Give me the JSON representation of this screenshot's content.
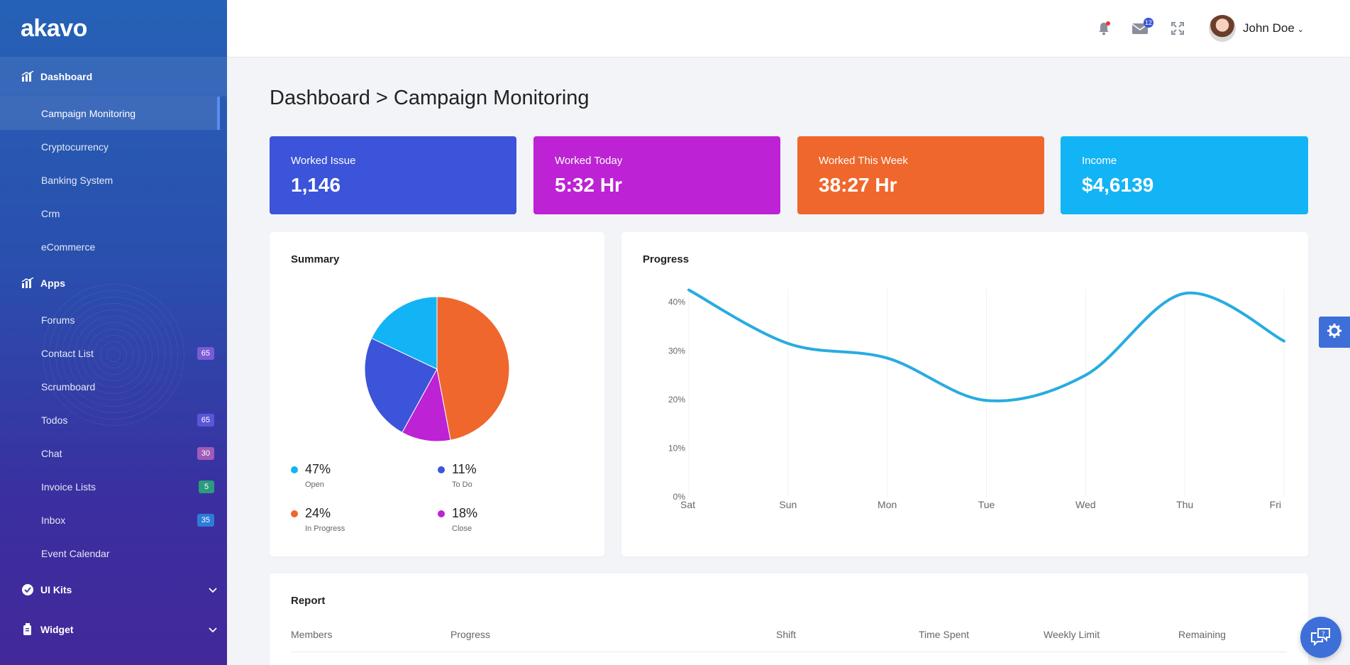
{
  "brand": "akavo",
  "colors": {
    "blue": "#3b54d9",
    "magenta": "#bd22d4",
    "orange": "#ef672c",
    "cyan": "#13b4f5",
    "line": "#28ace0"
  },
  "sidebar": {
    "dashboard": {
      "label": "Dashboard",
      "items": [
        {
          "label": "Campaign Monitoring",
          "active": true
        },
        {
          "label": "Cryptocurrency"
        },
        {
          "label": "Banking System"
        },
        {
          "label": "Crm"
        },
        {
          "label": "eCommerce"
        }
      ]
    },
    "apps": {
      "label": "Apps",
      "items": [
        {
          "label": "Forums",
          "badge": ""
        },
        {
          "label": "Contact List",
          "badge": "65",
          "badge_color": "#7a5ad6"
        },
        {
          "label": "Scrumboard",
          "badge": ""
        },
        {
          "label": "Todos",
          "badge": "65",
          "badge_color": "#5a56d9"
        },
        {
          "label": "Chat",
          "badge": "30",
          "badge_color": "#a05bb8"
        },
        {
          "label": "Invoice Lists",
          "badge": "5",
          "badge_color": "#2b9c7c"
        },
        {
          "label": "Inbox",
          "badge": "35",
          "badge_color": "#2e7cd9"
        },
        {
          "label": "Event Calendar",
          "badge": ""
        }
      ]
    },
    "ui_kits": {
      "label": "UI Kits"
    },
    "widget": {
      "label": "Widget"
    }
  },
  "topbar": {
    "mail_count": "12",
    "user_name": "John Doe",
    "icons": [
      "bell-icon",
      "mail-icon",
      "fullscreen-icon"
    ]
  },
  "page": {
    "title": "Dashboard > Campaign Monitoring"
  },
  "stats": [
    {
      "label": "Worked Issue",
      "value": "1,146"
    },
    {
      "label": "Worked Today",
      "value": "5:32 Hr"
    },
    {
      "label": "Worked This Week",
      "value": "38:27 Hr"
    },
    {
      "label": "Income",
      "value": "$4,6139"
    }
  ],
  "summary": {
    "title": "Summary",
    "legend": [
      {
        "pct": "47%",
        "label": "Open"
      },
      {
        "pct": "11%",
        "label": "To Do"
      },
      {
        "pct": "24%",
        "label": "In Progress"
      },
      {
        "pct": "18%",
        "label": "Close"
      }
    ]
  },
  "progress": {
    "title": "Progress"
  },
  "report": {
    "title": "Report",
    "columns": [
      "Members",
      "Progress",
      "Shift",
      "Time Spent",
      "Weekly Limit",
      "Remaining"
    ]
  },
  "chart_data": [
    {
      "type": "pie",
      "title": "Summary",
      "slices": [
        {
          "label": "In Progress",
          "value": 47,
          "color": "#ef672c"
        },
        {
          "label": "Close",
          "value": 11,
          "color": "#bd22d4"
        },
        {
          "label": "To Do",
          "value": 24,
          "color": "#3b54d9"
        },
        {
          "label": "Open",
          "value": 18,
          "color": "#13b4f5"
        }
      ]
    },
    {
      "type": "line",
      "title": "Progress",
      "categories": [
        "Sat",
        "Sun",
        "Mon",
        "Tue",
        "Wed",
        "Thu",
        "Fri"
      ],
      "y_ticks": [
        "0%",
        "10%",
        "20%",
        "30%",
        "40%"
      ],
      "values": [
        42.5,
        31.5,
        28.5,
        19.8,
        25.0,
        41.8,
        32.0
      ],
      "ylim": [
        0,
        42
      ],
      "color": "#28ace0"
    }
  ]
}
